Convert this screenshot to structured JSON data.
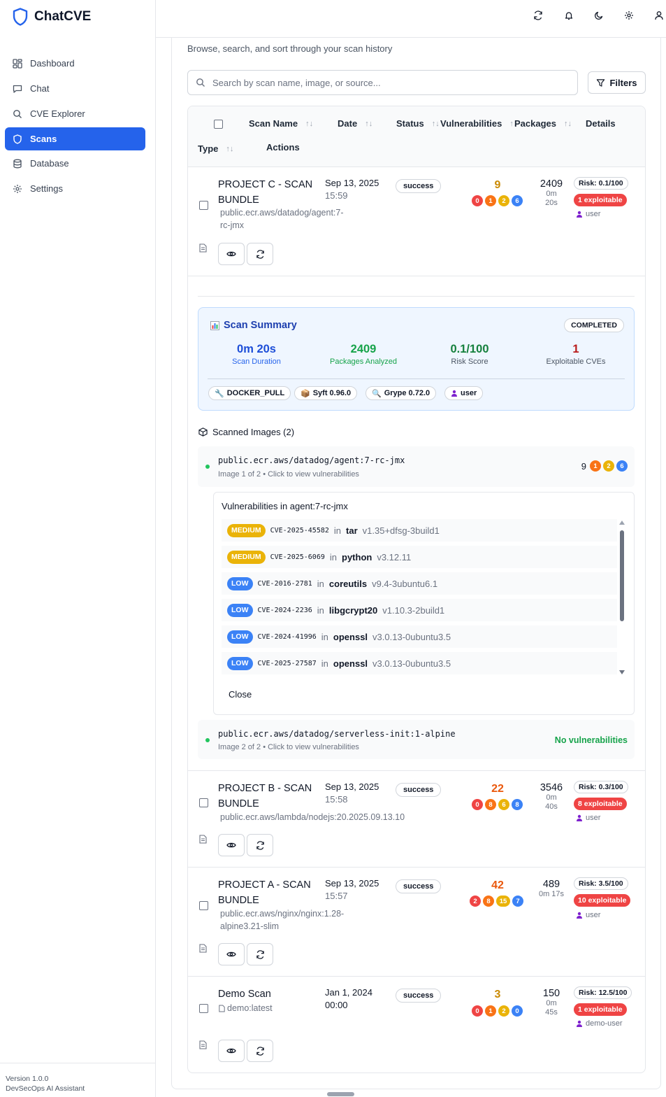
{
  "app": {
    "name": "ChatCVE",
    "version": "Version 1.0.0",
    "tagline": "DevSecOps AI Assistant"
  },
  "sidebar": {
    "items": [
      {
        "label": "Dashboard",
        "icon": "dashboard-icon"
      },
      {
        "label": "Chat",
        "icon": "chat-icon"
      },
      {
        "label": "CVE Explorer",
        "icon": "search-icon"
      },
      {
        "label": "Scans",
        "icon": "shield-icon",
        "active": true
      },
      {
        "label": "Database",
        "icon": "database-icon"
      },
      {
        "label": "Settings",
        "icon": "gear-icon"
      }
    ]
  },
  "topbar": {
    "icons": [
      "refresh-icon",
      "bell-icon",
      "moon-icon",
      "gear-icon",
      "user-icon"
    ]
  },
  "page": {
    "subtitle": "Browse, search, and sort through your scan history",
    "search_placeholder": "Search by scan name, image, or source...",
    "filters_label": "Filters"
  },
  "table": {
    "headers": {
      "scan_name": "Scan Name",
      "date": "Date",
      "status": "Status",
      "vulnerabilities": "Vulnerabilities",
      "packages": "Packages",
      "details": "Details",
      "type": "Type",
      "actions": "Actions"
    },
    "rows": [
      {
        "name_line1": "PROJECT C - SCAN",
        "name_line2": "BUNDLE",
        "image_line1": "public.ecr.aws/datadog/agent:7-",
        "image_line2": "rc-jmx",
        "date": "Sep 13, 2025",
        "time": "15:59",
        "status": "success",
        "vuln_total": "9",
        "sev": [
          "0",
          "1",
          "2",
          "6"
        ],
        "packages": "2409",
        "dur1": "0m",
        "dur2": "20s",
        "risk": "Risk: 0.1/100",
        "exploitable": "1 exploitable",
        "user": "user"
      },
      {
        "name_line1": "PROJECT B - SCAN",
        "name_line2": "BUNDLE",
        "image_line1": "public.ecr.aws/lambda/nodejs:20.2025.09.13.10",
        "image_line2": "",
        "date": "Sep 13, 2025",
        "time": "15:58",
        "status": "success",
        "vuln_total": "22",
        "sev": [
          "0",
          "8",
          "6",
          "8"
        ],
        "packages": "3546",
        "dur1": "0m",
        "dur2": "40s",
        "risk": "Risk: 0.3/100",
        "exploitable": "8 exploitable",
        "user": "user"
      },
      {
        "name_line1": "PROJECT A - SCAN",
        "name_line2": "BUNDLE",
        "image_line1": "public.ecr.aws/nginx/nginx:1.28-",
        "image_line2": "alpine3.21-slim",
        "date": "Sep 13, 2025",
        "time": "15:57",
        "status": "success",
        "vuln_total": "42",
        "sev": [
          "2",
          "8",
          "15",
          "7"
        ],
        "packages": "489",
        "dur1": "0m 17s",
        "dur2": "",
        "risk": "Risk: 3.5/100",
        "exploitable": "10 exploitable",
        "user": "user"
      },
      {
        "name_line1": "Demo Scan",
        "name_line2": "",
        "image_line1": "demo:latest",
        "image_line2": "",
        "date": "Jan 1, 2024",
        "time": "00:00",
        "status": "success",
        "vuln_total": "3",
        "sev": [
          "0",
          "1",
          "2",
          "0"
        ],
        "packages": "150",
        "dur1": "0m",
        "dur2": "45s",
        "risk": "Risk: 12.5/100",
        "exploitable": "1 exploitable",
        "user": "demo-user"
      }
    ]
  },
  "summary": {
    "title": "Scan Summary",
    "status": "COMPLETED",
    "stats": [
      {
        "value": "0m 20s",
        "label": "Scan Duration",
        "color": "#1d4ed8"
      },
      {
        "value": "2409",
        "label": "Packages Analyzed",
        "color": "#16a34a"
      },
      {
        "value": "0.1/100",
        "label": "Risk Score",
        "color": "#15803d"
      },
      {
        "value": "1",
        "label": "Exploitable CVEs",
        "color": "#b91c1c"
      }
    ],
    "chips": [
      "DOCKER_PULL",
      "Syft 0.96.0",
      "Grype 0.72.0",
      "user"
    ]
  },
  "scanned_images": {
    "title": "Scanned Images (2)",
    "images": [
      {
        "name": "public.ecr.aws/datadog/agent:7-rc-jmx",
        "sub": "Image 1 of 2 • Click to view vulnerabilities",
        "total": "9",
        "sev": [
          "1",
          "2",
          "6"
        ]
      },
      {
        "name": "public.ecr.aws/datadog/serverless-init:1-alpine",
        "sub": "Image 2 of 2 • Click to view vulnerabilities",
        "none": "No vulnerabilities"
      }
    ]
  },
  "vuln_panel": {
    "title": "Vulnerabilities in agent:7-rc-jmx",
    "in_word": "in",
    "close_label": "Close",
    "items": [
      {
        "severity": "MEDIUM",
        "cve": "CVE-2025-45582",
        "pkg": "tar",
        "ver": "v1.35+dfsg-3build1"
      },
      {
        "severity": "MEDIUM",
        "cve": "CVE-2025-6069",
        "pkg": "python",
        "ver": "v3.12.11"
      },
      {
        "severity": "LOW",
        "cve": "CVE-2016-2781",
        "pkg": "coreutils",
        "ver": "v9.4-3ubuntu6.1"
      },
      {
        "severity": "LOW",
        "cve": "CVE-2024-2236",
        "pkg": "libgcrypt20",
        "ver": "v1.10.3-2build1"
      },
      {
        "severity": "LOW",
        "cve": "CVE-2024-41996",
        "pkg": "openssl",
        "ver": "v3.0.13-0ubuntu3.5"
      },
      {
        "severity": "LOW",
        "cve": "CVE-2025-27587",
        "pkg": "openssl",
        "ver": "v3.0.13-0ubuntu3.5"
      }
    ]
  }
}
